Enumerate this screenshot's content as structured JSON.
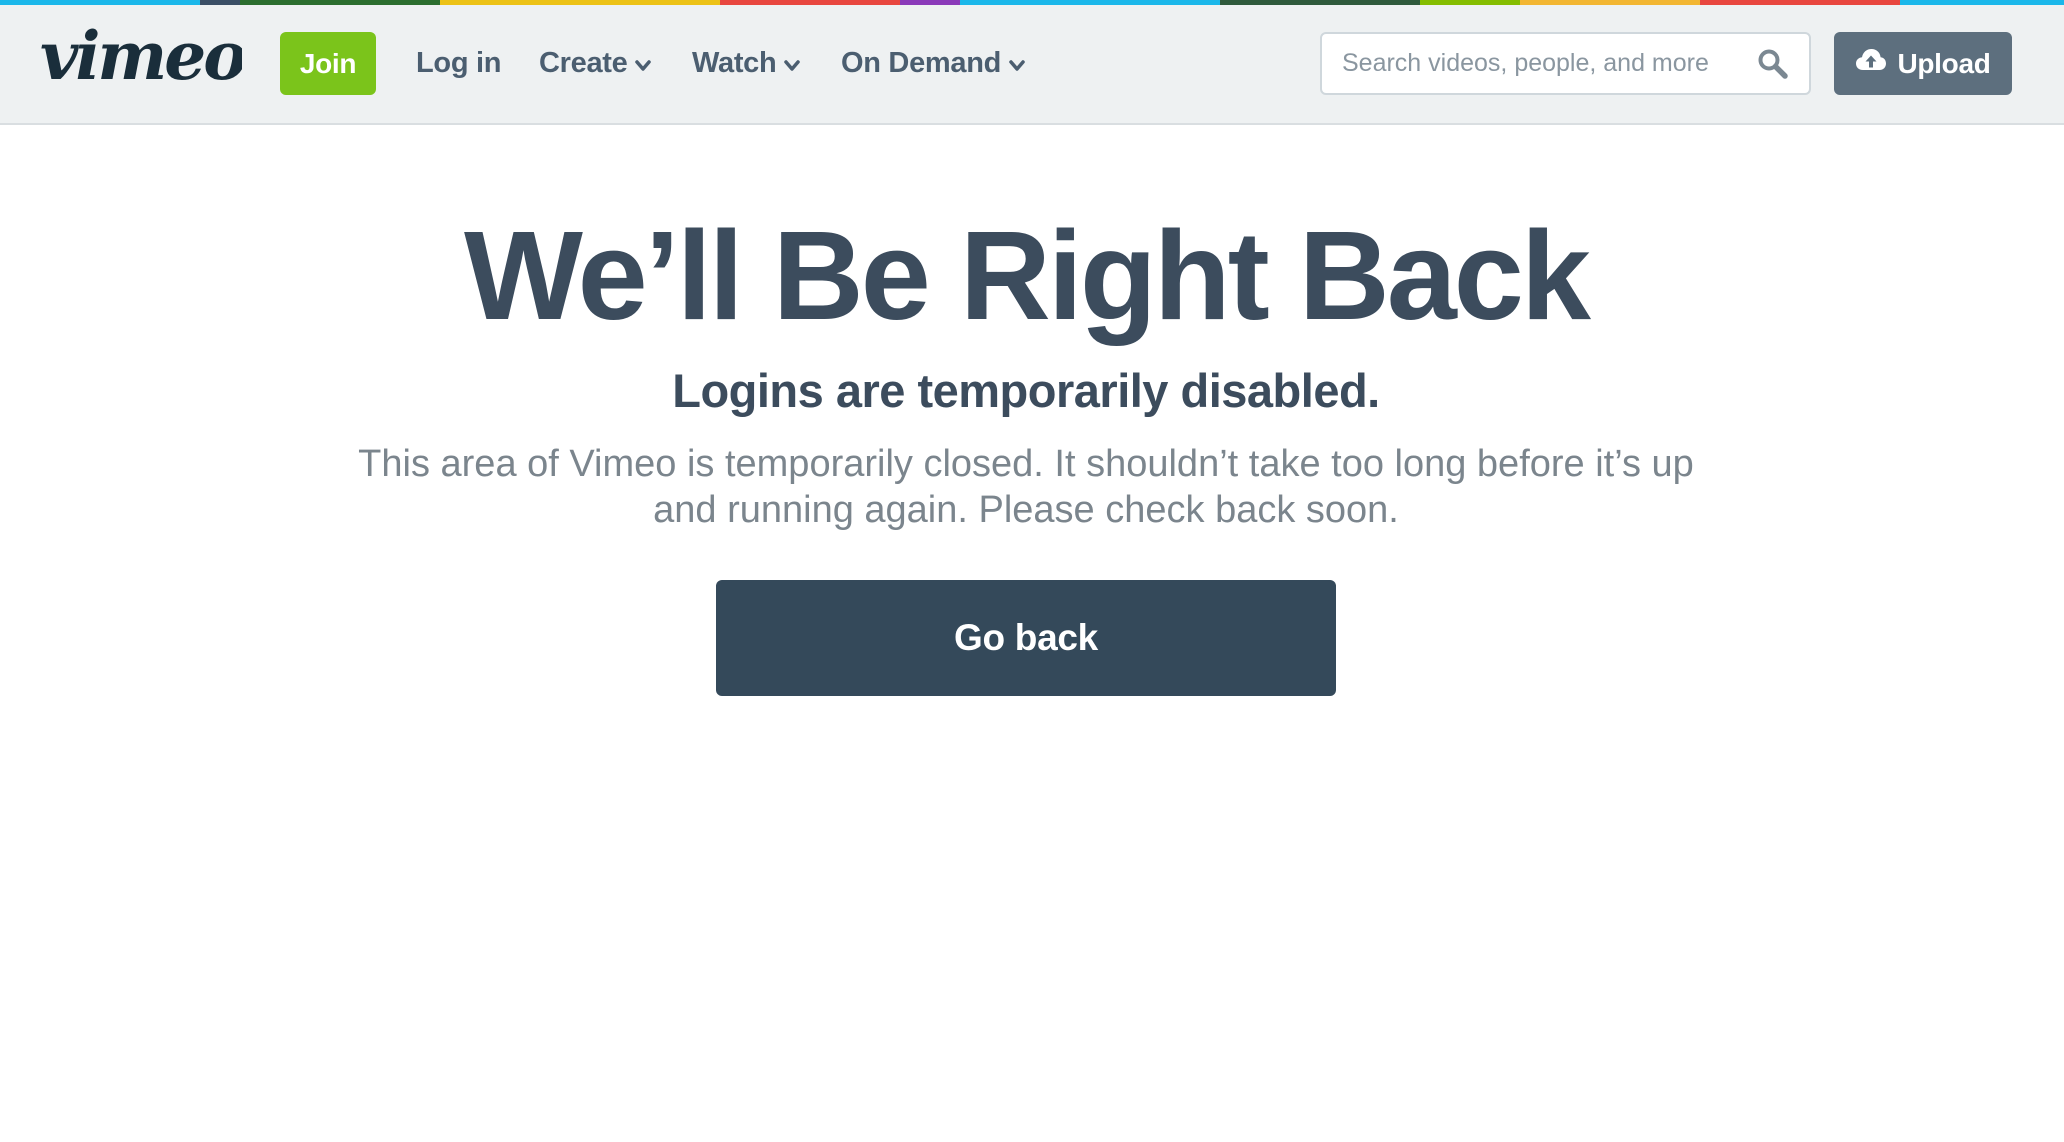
{
  "brand": {
    "logo_text": "vimeo",
    "stripe_colors": [
      "#1ab7ea",
      "#3b4f66",
      "#ff8a00",
      "#84bd00",
      "#2c6e2f",
      "#ecc217",
      "#ff5a5f",
      "#e8473f",
      "#8a3ab9",
      "#1ab7ea",
      "#2f5a3c",
      "#84bd00",
      "#f2b632",
      "#1ab7ea",
      "#e8473f",
      "#3b4f66"
    ],
    "accent": "#7bc41b",
    "primary_text": "#3c4c5d"
  },
  "nav": {
    "join_label": "Join",
    "login_label": "Log in",
    "create_label": "Create",
    "watch_label": "Watch",
    "on_demand_label": "On Demand",
    "search_placeholder": "Search videos, people, and more",
    "upload_label": "Upload",
    "icons": {
      "dropdown": "chevron-down-icon",
      "search": "magnifier-icon",
      "upload": "cloud-upload-icon"
    }
  },
  "main": {
    "title": "We’ll Be Right Back",
    "subtitle": "Logins are temporarily disabled.",
    "description": "This area of Vimeo is temporarily closed. It shouldn’t take too long before it’s up and running again. Please check back soon.",
    "go_back_label": "Go back"
  }
}
